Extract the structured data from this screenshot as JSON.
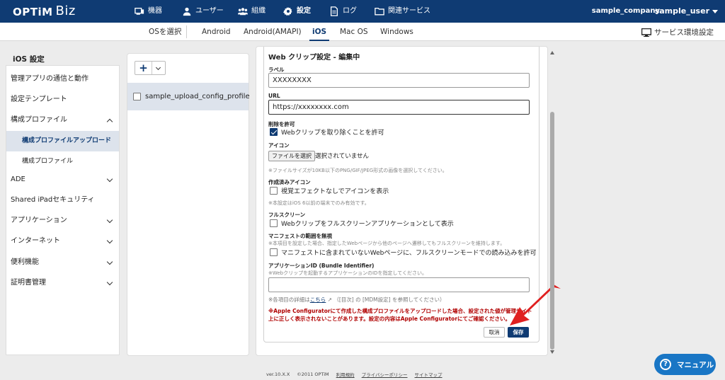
{
  "app": {
    "logo": "OPTiM",
    "logo_suffix": "Biz"
  },
  "header": {
    "nav": [
      {
        "label": "機器",
        "icon": "device-icon"
      },
      {
        "label": "ユーザー",
        "icon": "user-icon"
      },
      {
        "label": "組織",
        "icon": "org-icon"
      },
      {
        "label": "設定",
        "icon": "gear-icon"
      },
      {
        "label": "ログ",
        "icon": "log-icon"
      },
      {
        "label": "関連サービス",
        "icon": "folder-icon"
      }
    ],
    "company": "sample_company",
    "user": "sample_user"
  },
  "os_tabs": {
    "select_label": "OSを選択",
    "tabs": [
      "Android",
      "Android(AMAPI)",
      "iOS",
      "Mac OS",
      "Windows"
    ],
    "active": "iOS",
    "env_link": "サービス環境設定"
  },
  "sidebar": {
    "title": "iOS 設定",
    "items": [
      {
        "label": "管理アプリの通信と動作"
      },
      {
        "label": "設定テンプレート"
      },
      {
        "label": "構成プロファイル"
      },
      {
        "label": "構成プロファイルアップロード"
      },
      {
        "label": "構成プロファイル"
      },
      {
        "label": "ADE"
      },
      {
        "label": "Shared iPadセキュリティ"
      },
      {
        "label": "アプリケーション"
      },
      {
        "label": "インターネット"
      },
      {
        "label": "便利機能"
      },
      {
        "label": "証明書管理"
      }
    ]
  },
  "profiles": {
    "add_label": "+",
    "items": [
      {
        "label": "sample_upload_config_profile"
      }
    ]
  },
  "form": {
    "title": "Web クリップ設定 - 編集中",
    "label_field": {
      "label": "ラベル",
      "value": "XXXXXXXX"
    },
    "url_field": {
      "label": "URL",
      "value": "https://xxxxxxxx.com"
    },
    "removable": {
      "label": "削除を許可",
      "checkbox": "Webクリップを取り除くことを許可"
    },
    "icon": {
      "label": "アイコン",
      "button": "ファイルを選択",
      "status": "選択されていません",
      "note": "※ファイルサイズが10KB以下のPNG/GIF/JPEG形式の画像を選択してください。"
    },
    "precomposed": {
      "label": "作成済みアイコン",
      "checkbox": "視覚エフェクトなしでアイコンを表示",
      "note": "※本設定はiOS 6以前の端末でのみ有効です。"
    },
    "fullscreen": {
      "label": "フルスクリーン",
      "checkbox": "Webクリップをフルスクリーンアプリケーションとして表示"
    },
    "ignore_manifest": {
      "label": "マニフェストの範囲を無視",
      "note": "※本項目を設定した場合、指定したWebページから他のページへ遷移してもフルスクリーンを維持します。",
      "checkbox": "マニフェストに含まれていないWebページに、フルスクリーンモードでの読み込みを許可"
    },
    "bundle_id": {
      "label": "アプリケーションID (Bundle Identifier)",
      "note": "※Webクリップを起動するアプリケーションのIDを指定してください。",
      "value": ""
    },
    "detail_prefix": "※各項目の詳細は",
    "detail_link": "こちら",
    "detail_suffix": "（[目次] の [MDM設定] を参照してください）",
    "warning": "※Apple Configuratorにて作成した構成プロファイルをアップロードした場合、設定された値が管理サイト上に正しく表示されないことがあります。設定の内容はApple Configuratorにてご確認ください。",
    "cancel": "取消",
    "save": "保存"
  },
  "footer": {
    "version": "ver.10.X.X",
    "copyright": "©2011 OPTiM",
    "terms": "利用規約",
    "privacy": "プライバシーポリシー",
    "sitemap": "サイトマップ"
  },
  "manual_button": "マニュアル",
  "colors": {
    "header": "#0f3b73",
    "accent": "#1976c5",
    "warning": "#b00000",
    "arrow": "#e02020"
  }
}
